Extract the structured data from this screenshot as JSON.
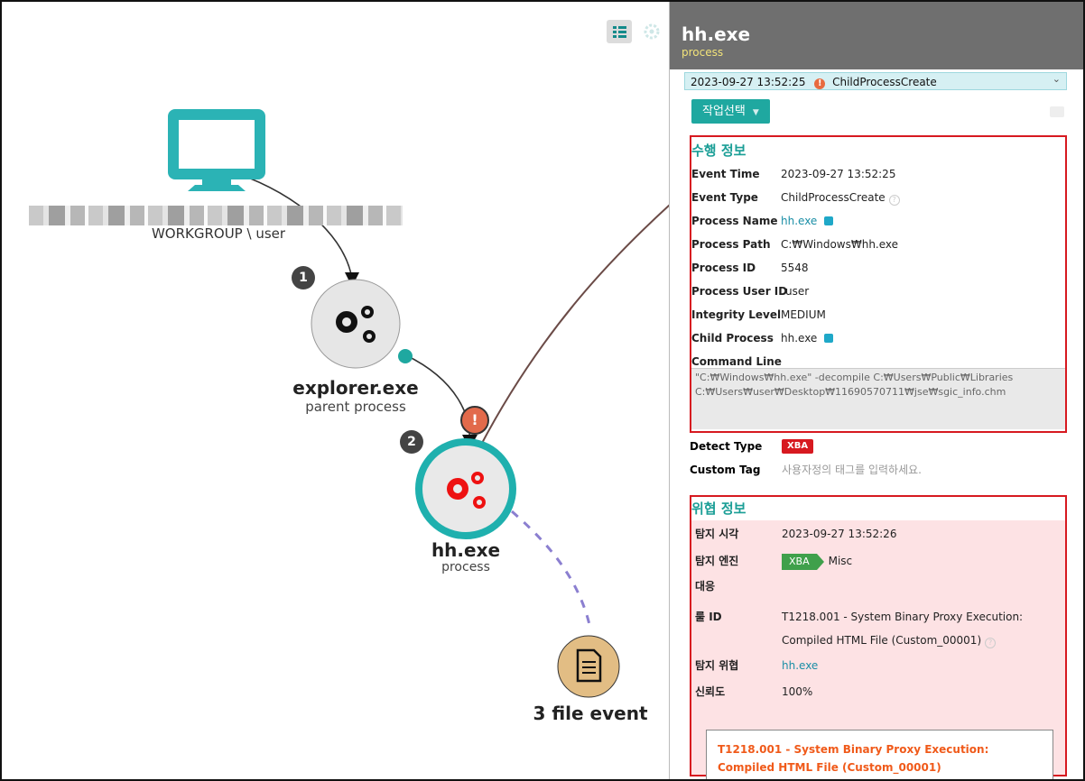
{
  "graph": {
    "host_label": "WORKGROUP \\ user",
    "parent": {
      "name": "explorer.exe",
      "role": "parent process",
      "step": "1"
    },
    "current": {
      "name": "hh.exe",
      "role": "process",
      "step": "2",
      "alert": "!"
    },
    "file_event": {
      "label": "3 file event"
    },
    "colors": {
      "teal": "#1fb0ae",
      "alert": "#e26a4b",
      "dashed": "#8b7fd0",
      "file": "#e2bd84"
    },
    "icons": {
      "host": "monitor-icon",
      "process": "gears-icon",
      "file": "document-icon"
    }
  },
  "panel": {
    "title": "hh.exe",
    "subtitle": "process",
    "event_selector": "2023-09-27 13:52:25",
    "event_name": "ChildProcessCreate",
    "action_button": "작업선택",
    "exec_info": {
      "header": "수행 정보",
      "rows": [
        {
          "key": "Event Time",
          "value": "2023-09-27 13:52:25"
        },
        {
          "key": "Event Type",
          "value": "ChildProcessCreate"
        },
        {
          "key": "Process Name",
          "value": "hh.exe"
        },
        {
          "key": "Process Path",
          "value": "C:₩Windows₩hh.exe"
        },
        {
          "key": "Process ID",
          "value": "5548"
        },
        {
          "key": "Process User ID",
          "value": "user"
        },
        {
          "key": "Integrity Level",
          "value": "MEDIUM"
        },
        {
          "key": "Child Process",
          "value": "hh.exe"
        },
        {
          "key": "Command Line",
          "value": ""
        }
      ],
      "command_line_1": "\"C:₩Windows₩hh.exe\" -decompile C:₩Users₩Public₩Libraries",
      "command_line_2": "C:₩Users₩user₩Desktop₩11690570711₩jse₩sgic_info.chm"
    },
    "detect_type_label": "Detect Type",
    "detect_type": "XBA",
    "custom_tag_label": "Custom Tag",
    "custom_tag_placeholder": "사용자정의 태그를 입력하세요.",
    "threat_info": {
      "header": "위협 정보",
      "detect_time_label": "탐지 시각",
      "detect_time": "2023-09-27 13:52:26",
      "engine_label": "탐지 엔진",
      "engine_tag": "XBA",
      "engine_value": "Misc",
      "response_label": "대응",
      "rule_label": "룰 ID",
      "rule_line1": "T1218.001 - System Binary Proxy Execution:",
      "rule_line2": "Compiled HTML File (Custom_00001)",
      "threat_label": "탐지 위협",
      "threat_value": "hh.exe",
      "confidence_label": "신뢰도",
      "confidence_value": "100%",
      "summary": "T1218.001 - System Binary Proxy Execution: Compiled HTML File (Custom_00001)"
    }
  }
}
